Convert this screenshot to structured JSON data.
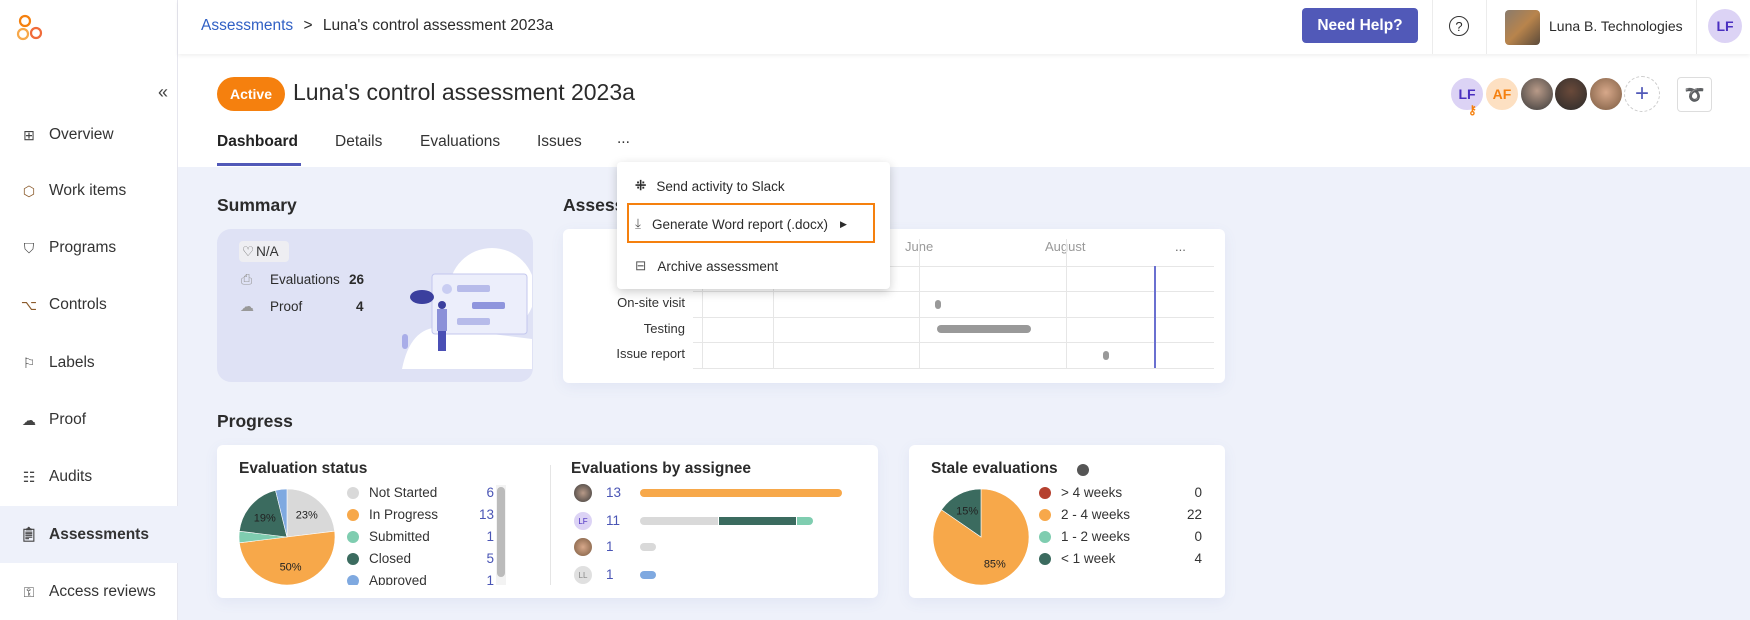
{
  "sidebar": {
    "collapse_icon": "«",
    "items": [
      {
        "label": "Overview",
        "icon": "layout-icon"
      },
      {
        "label": "Work items",
        "icon": "box-icon"
      },
      {
        "label": "Programs",
        "icon": "shield-icon"
      },
      {
        "label": "Controls",
        "icon": "flow-icon"
      },
      {
        "label": "Labels",
        "icon": "bookmark-icon"
      },
      {
        "label": "Proof",
        "icon": "cloud-upload-icon"
      },
      {
        "label": "Audits",
        "icon": "audit-icon"
      },
      {
        "label": "Assessments",
        "icon": "clipboard-icon",
        "active": true
      },
      {
        "label": "Access reviews",
        "icon": "key-icon"
      }
    ]
  },
  "header": {
    "breadcrumb_root": "Assessments",
    "breadcrumb_sep": ">",
    "breadcrumb_current": "Luna's control assessment 2023a",
    "help_button": "Need Help?",
    "org_name": "Luna B. Technologies",
    "user_initials": "LF"
  },
  "page": {
    "status_badge": "Active",
    "title": "Luna's control assessment 2023a",
    "tabs": [
      "Dashboard",
      "Details",
      "Evaluations",
      "Issues",
      "..."
    ],
    "members": [
      "LF",
      "AF"
    ]
  },
  "menu": {
    "items": [
      "Send activity to Slack",
      "Generate Word report (.docx)",
      "Archive assessment"
    ]
  },
  "summary": {
    "title": "Summary",
    "health": "N/A",
    "evaluations_label": "Evaluations",
    "evaluations": "26",
    "proof_label": "Proof",
    "proof": "4"
  },
  "timeline": {
    "title": "Assess",
    "months": [
      "June",
      "August",
      "..."
    ],
    "rows": [
      "Evidence",
      "On-site visit",
      "Testing",
      "Issue report"
    ]
  },
  "progress": {
    "title": "Progress",
    "status_title": "Evaluation status",
    "assignee_title": "Evaluations by assignee",
    "assignees": [
      {
        "initials": "",
        "count": "13"
      },
      {
        "initials": "LF",
        "count": "11"
      },
      {
        "initials": "",
        "count": "1"
      },
      {
        "initials": "LL",
        "count": "1"
      }
    ],
    "stale_title": "Stale evaluations"
  },
  "chart_data": [
    {
      "type": "pie",
      "title": "Evaluation status",
      "categories": [
        "Not Started",
        "In Progress",
        "Submitted",
        "Closed",
        "Approved"
      ],
      "values": [
        6,
        13,
        1,
        5,
        1
      ],
      "colors": [
        "#d9d9d9",
        "#f7a84a",
        "#7fcdb0",
        "#3b6b5f",
        "#7fa9e0"
      ],
      "data_labels": [
        "23%",
        "50%",
        "",
        "19%",
        ""
      ]
    },
    {
      "type": "pie",
      "title": "Stale evaluations",
      "categories": [
        "> 4 weeks",
        "2 - 4 weeks",
        "1 - 2 weeks",
        "< 1 week"
      ],
      "values": [
        0,
        22,
        0,
        4
      ],
      "colors": [
        "#b5412f",
        "#f7a84a",
        "#7fcdb0",
        "#3b6b5f"
      ],
      "data_labels": [
        "",
        "85%",
        "",
        "15%"
      ]
    },
    {
      "type": "bar",
      "title": "Evaluations by assignee",
      "stacked": true,
      "series_colors": [
        "#f7a84a",
        "#d9d9d9",
        "#3b6b5f",
        "#7fcdb0",
        "#7fa9e0"
      ],
      "bars": [
        [
          {
            "color": "#f7a84a",
            "value": 13
          }
        ],
        [
          {
            "color": "#d9d9d9",
            "value": 5
          },
          {
            "color": "#3b6b5f",
            "value": 5
          },
          {
            "color": "#7fcdb0",
            "value": 1
          }
        ],
        [
          {
            "color": "#d9d9d9",
            "value": 1
          }
        ],
        [
          {
            "color": "#7fa9e0",
            "value": 1
          }
        ]
      ]
    }
  ],
  "colors": {
    "accent": "#5159b8",
    "active_badge": "#f5800e",
    "menu_highlight": "#f5800e"
  }
}
